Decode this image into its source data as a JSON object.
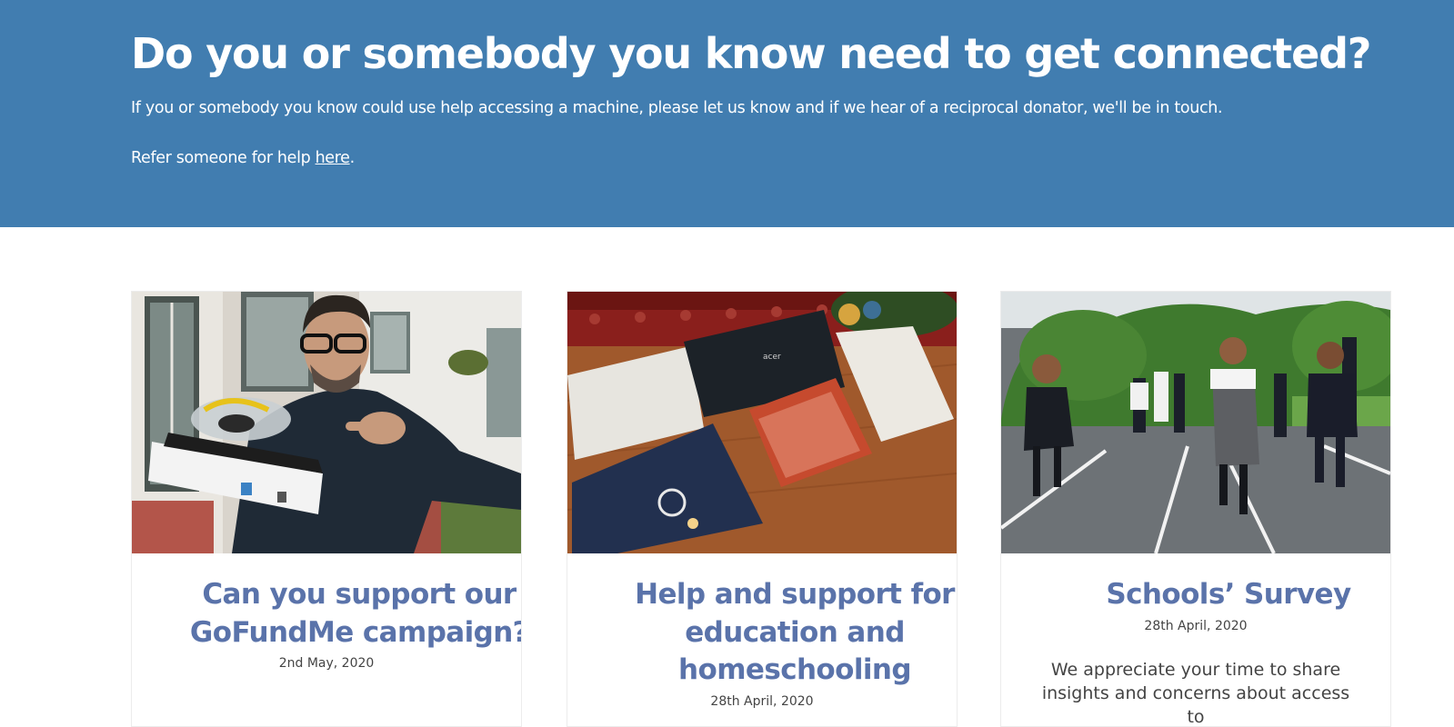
{
  "hero": {
    "title": "Do you or somebody you know need to get connected?",
    "text": "If you or somebody you know could use help accessing a machine, please let us know and if we hear of a reciprocal donator, we'll be in touch.",
    "refer_prefix": "Refer someone for help ",
    "refer_link": "here",
    "refer_suffix": ".",
    "background": "#417db0"
  },
  "cards": [
    {
      "title": "Can you support our GoFundMe campaign?",
      "date": "2nd May, 2020",
      "image": "man-holding-laptop-photo"
    },
    {
      "title": "Help and support for education and homeschooling",
      "date": "28th April, 2020",
      "image": "laptops-on-table-photo"
    },
    {
      "title": "Schools’ Survey",
      "date": "28th April, 2020",
      "excerpt": "We appreciate your time to share insights and concerns about access to",
      "image": "children-running-playground-photo"
    }
  ],
  "colors": {
    "card_title": "#5a73aa",
    "hero_bg": "#417db0"
  }
}
